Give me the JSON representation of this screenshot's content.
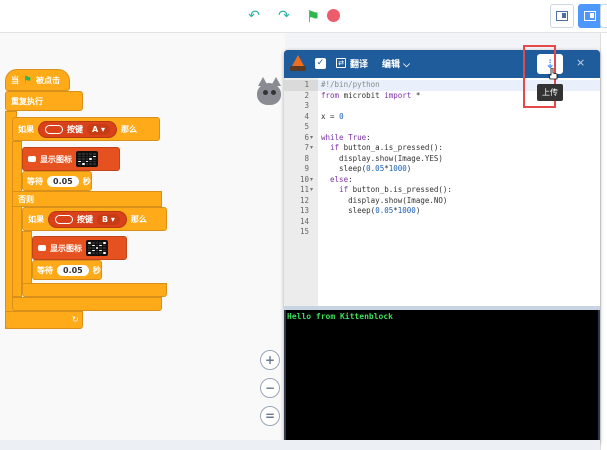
{
  "toolbar": {
    "undo_icon": "undo-icon",
    "redo_icon": "redo-icon",
    "go_icon": "green-flag-icon",
    "stop_icon": "stop-icon"
  },
  "blocks": {
    "when_clicked_label": "当",
    "when_clicked_suffix": "被点击",
    "forever_label": "重复执行",
    "if_label": "如果",
    "button_label": "按键",
    "button_a": "A",
    "button_b": "B",
    "then_label": "那么",
    "show_image_label": "显示图标",
    "wait_label": "等待",
    "wait_value": "0.05",
    "seconds_label": "秒",
    "else_label": "否则"
  },
  "editor": {
    "translate_label": "翻译",
    "edit_menu_label": "编辑",
    "upload_tooltip": "上传",
    "close_label": "×",
    "code_lines": [
      {
        "n": "1",
        "t": "#!/bin/python",
        "cls": "cm"
      },
      {
        "n": "2",
        "t": "from microbit import *"
      },
      {
        "n": "3",
        "t": ""
      },
      {
        "n": "4",
        "t": "x = 0"
      },
      {
        "n": "5",
        "t": ""
      },
      {
        "n": "6",
        "t": "while True:",
        "fold": true
      },
      {
        "n": "7",
        "t": "  if button_a.is_pressed():",
        "fold": true
      },
      {
        "n": "8",
        "t": "    display.show(Image.YES)"
      },
      {
        "n": "9",
        "t": "    sleep(0.05*1000)"
      },
      {
        "n": "10",
        "t": "  else:",
        "fold": true
      },
      {
        "n": "11",
        "t": "    if button_b.is_pressed():",
        "fold": true
      },
      {
        "n": "12",
        "t": "      display.show(Image.NO)"
      },
      {
        "n": "13",
        "t": "      sleep(0.05*1000)"
      },
      {
        "n": "14",
        "t": ""
      },
      {
        "n": "15",
        "t": ""
      }
    ],
    "console_output": "Hello from Kittenblock"
  },
  "zoom": {
    "zoom_in": "+",
    "zoom_out": "−",
    "reset": "="
  }
}
